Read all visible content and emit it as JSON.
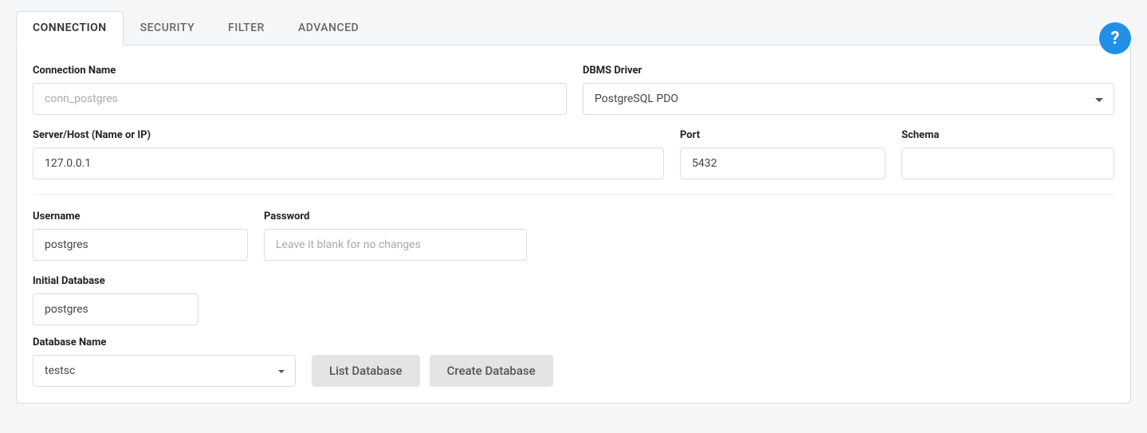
{
  "tabs": {
    "connection": "CONNECTION",
    "security": "SECURITY",
    "filter": "FILTER",
    "advanced": "ADVANCED"
  },
  "help_icon": "?",
  "labels": {
    "connection_name": "Connection Name",
    "dbms_driver": "DBMS Driver",
    "server_host": "Server/Host (Name or IP)",
    "port": "Port",
    "schema": "Schema",
    "username": "Username",
    "password": "Password",
    "initial_database": "Initial Database",
    "database_name": "Database Name"
  },
  "placeholders": {
    "connection_name": "conn_postgres",
    "password": "Leave it blank for no changes"
  },
  "values": {
    "dbms_driver": "PostgreSQL PDO",
    "server_host": "127.0.0.1",
    "port": "5432",
    "schema": "",
    "username": "postgres",
    "initial_database": "postgres",
    "database_name": "testsc"
  },
  "buttons": {
    "list_database": "List Database",
    "create_database": "Create Database"
  }
}
